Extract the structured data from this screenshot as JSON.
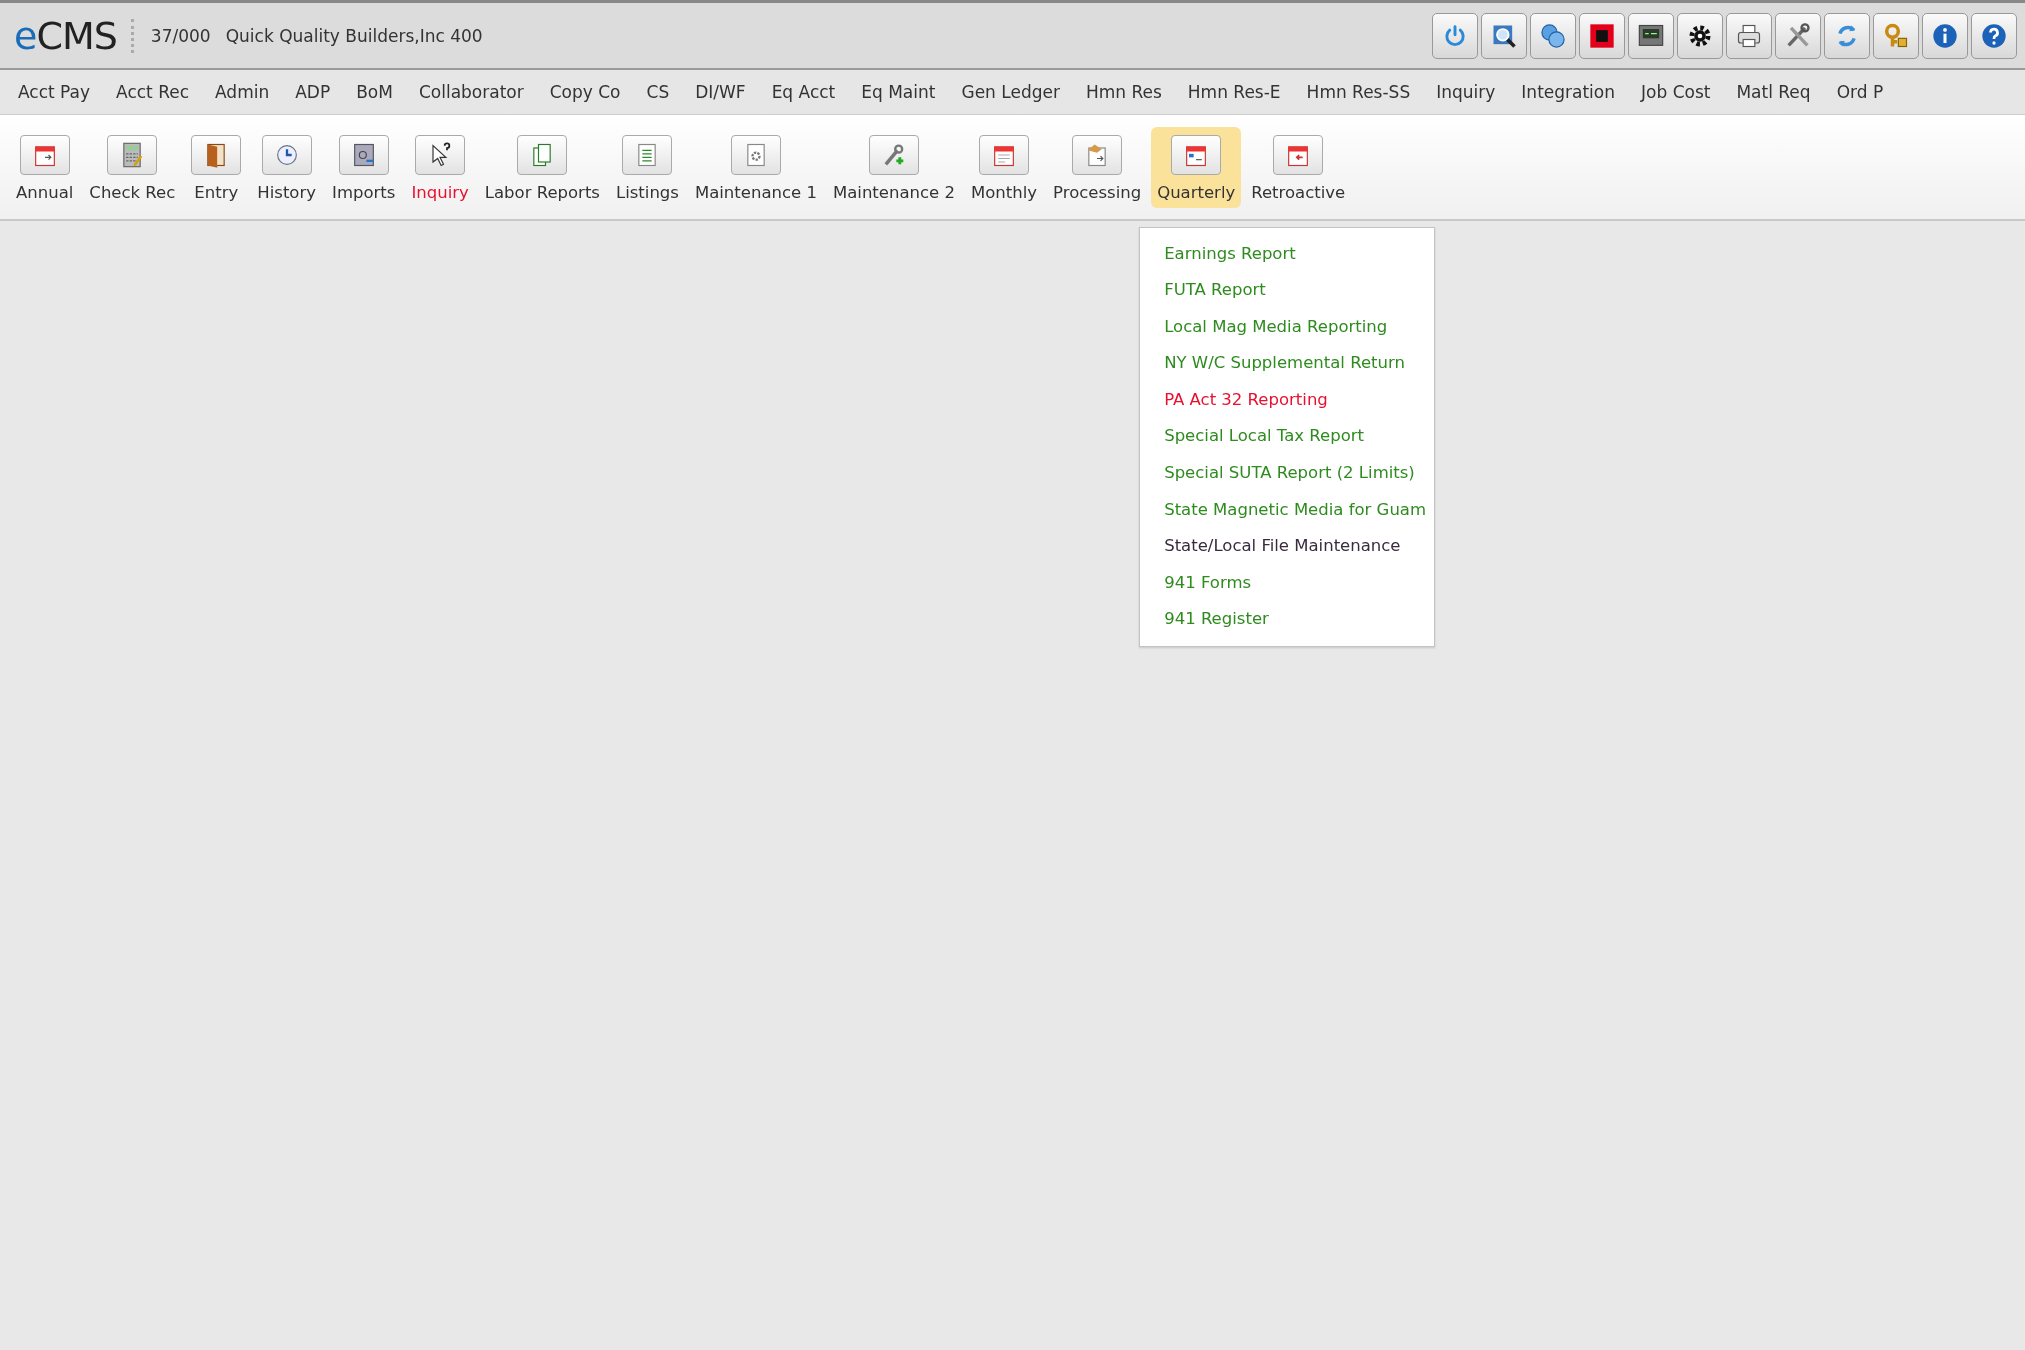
{
  "header": {
    "logo": "eCMS",
    "company_code": "37/000",
    "company_name": "Quick Quality Builders,Inc 400"
  },
  "menu_bar": [
    "Acct Pay",
    "Acct Rec",
    "Admin",
    "ADP",
    "BoM",
    "Collaborator",
    "Copy Co",
    "CS",
    "DI/WF",
    "Eq Acct",
    "Eq Maint",
    "Gen Ledger",
    "Hmn Res",
    "Hmn Res-E",
    "Hmn Res-SS",
    "Inquiry",
    "Integration",
    "Job Cost",
    "Matl Req",
    "Ord P"
  ],
  "toolbar": [
    {
      "label": "Annual",
      "selected": false,
      "highlighted": false
    },
    {
      "label": "Check Rec",
      "selected": false,
      "highlighted": false
    },
    {
      "label": "Entry",
      "selected": false,
      "highlighted": false
    },
    {
      "label": "History",
      "selected": false,
      "highlighted": false
    },
    {
      "label": "Imports",
      "selected": false,
      "highlighted": false
    },
    {
      "label": "Inquiry",
      "selected": false,
      "highlighted": true
    },
    {
      "label": "Labor Reports",
      "selected": false,
      "highlighted": false
    },
    {
      "label": "Listings",
      "selected": false,
      "highlighted": false
    },
    {
      "label": "Maintenance 1",
      "selected": false,
      "highlighted": false
    },
    {
      "label": "Maintenance 2",
      "selected": false,
      "highlighted": false
    },
    {
      "label": "Monthly",
      "selected": false,
      "highlighted": false
    },
    {
      "label": "Processing",
      "selected": false,
      "highlighted": false
    },
    {
      "label": "Quarterly",
      "selected": true,
      "highlighted": false
    },
    {
      "label": "Retroactive",
      "selected": false,
      "highlighted": false
    }
  ],
  "dropdown": [
    {
      "label": "Earnings Report",
      "color": "#2e8b1e"
    },
    {
      "label": "FUTA Report",
      "color": "#2e8b1e"
    },
    {
      "label": "Local Mag Media Reporting",
      "color": "#2e8b1e"
    },
    {
      "label": "NY W/C Supplemental Return",
      "color": "#2e8b1e"
    },
    {
      "label": "PA Act 32 Reporting",
      "color": "#e8102e"
    },
    {
      "label": "Special Local Tax Report",
      "color": "#2e8b1e"
    },
    {
      "label": "Special SUTA Report (2 Limits)",
      "color": "#2e8b1e"
    },
    {
      "label": "State Magnetic Media for Guam",
      "color": "#2e8b1e"
    },
    {
      "label": "State/Local File Maintenance",
      "color": "#3a2a40"
    },
    {
      "label": "941 Forms",
      "color": "#2e8b1e"
    },
    {
      "label": "941 Register",
      "color": "#2e8b1e"
    }
  ]
}
